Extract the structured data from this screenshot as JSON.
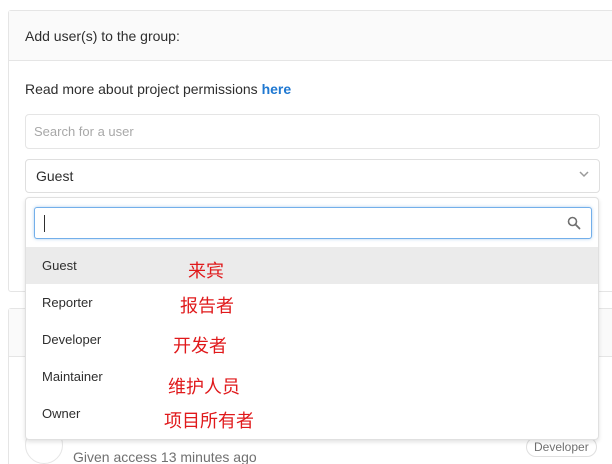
{
  "panel": {
    "title": "Add user(s) to the group:",
    "permissions_text": "Read more about project permissions ",
    "permissions_link": "here",
    "search_placeholder": "Search for a user",
    "role_selected": "Guest"
  },
  "dropdown": {
    "options": [
      {
        "label": "Guest",
        "annotation": "来宾",
        "active": true
      },
      {
        "label": "Reporter",
        "annotation": "报告者",
        "active": false
      },
      {
        "label": "Developer",
        "annotation": "开发者",
        "active": false
      },
      {
        "label": "Maintainer",
        "annotation": "维护人员",
        "active": false
      },
      {
        "label": "Owner",
        "annotation": "项目所有者",
        "active": false
      }
    ]
  },
  "member": {
    "access": "Given access 13 minutes ago",
    "role_badge": "Developer"
  },
  "colors": {
    "link": "#1f78d1",
    "annotation": "#e0191b",
    "active_row": "#ebebeb",
    "focus_border": "#73afea"
  }
}
